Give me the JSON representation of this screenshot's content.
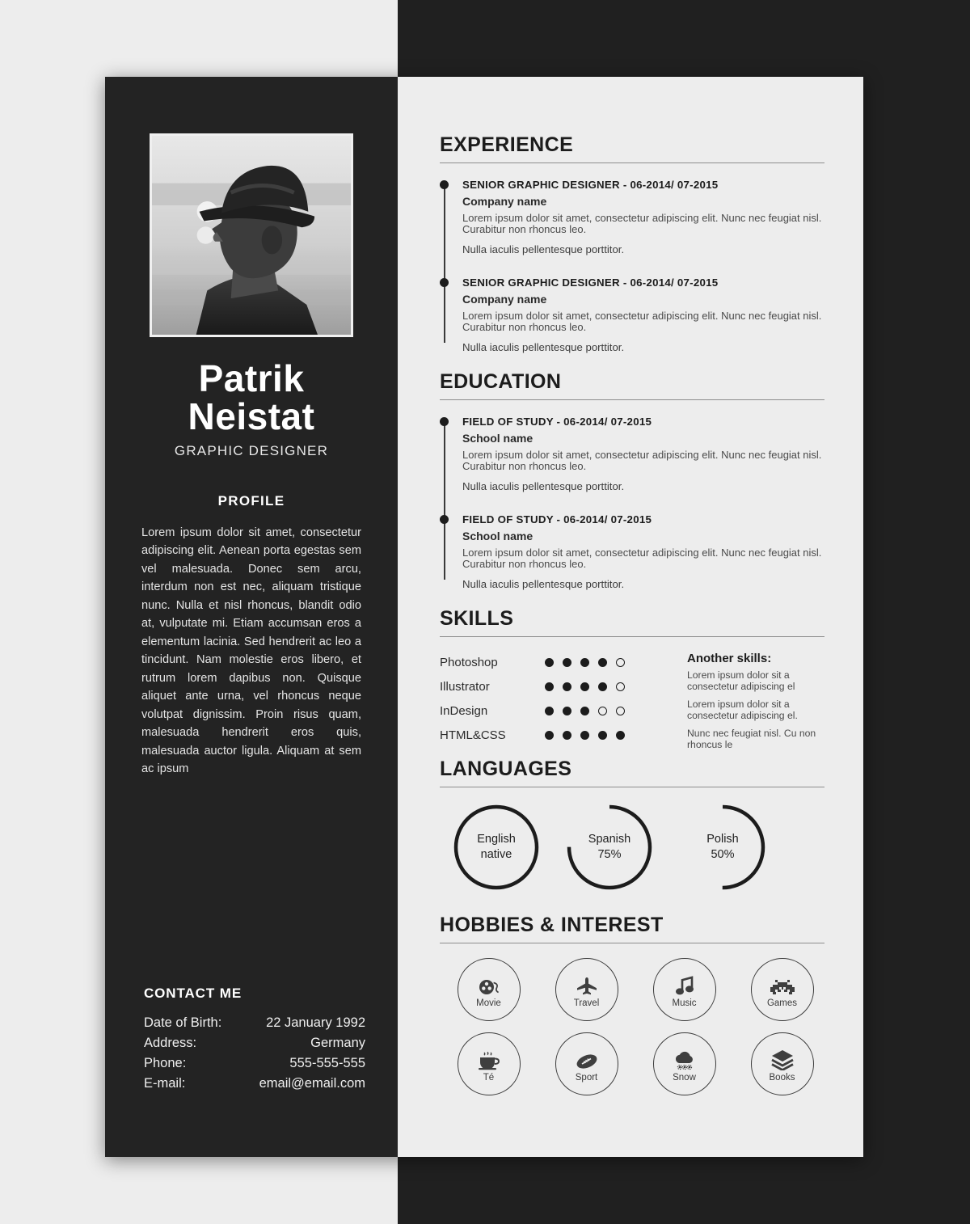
{
  "colors": {
    "page_background": "#ededed",
    "backdrop_dark": "#202020",
    "sidebar_dark": "#232323",
    "ink": "#1c1c1c",
    "rule": "#8d8d8d"
  },
  "sidebar": {
    "photo_alt": "portrait-photo",
    "name_line1": "Patrik",
    "name_line2": "Neistat",
    "role": "GRAPHIC DESIGNER",
    "profile_heading": "PROFILE",
    "profile_text": "Lorem ipsum dolor sit amet, consectetur adipiscing elit. Aenean porta egestas sem vel malesuada. Donec sem arcu, interdum non est nec, aliquam tristique nunc. Nulla et nisl rhoncus, blandit odio at, vulputate mi. Etiam accumsan eros a elementum lacinia. Sed hendrerit ac leo a tincidunt. Nam molestie eros libero, et rutrum lorem dapibus non. Quisque aliquet ante urna, vel rhoncus neque volutpat dignissim. Proin risus quam, malesuada hendrerit eros quis, malesuada auctor ligula. Aliquam at sem ac ipsum",
    "contact": {
      "title": "CONTACT ME",
      "rows": [
        {
          "label": "Date of Birth:",
          "value": "22 January 1992"
        },
        {
          "label": "Address:",
          "value": "Germany"
        },
        {
          "label": "Phone:",
          "value": "555-555-555"
        },
        {
          "label": "E-mail:",
          "value": "email@email.com"
        }
      ]
    }
  },
  "main": {
    "experience": {
      "title": "EXPERIENCE",
      "entries": [
        {
          "role": "SENIOR GRAPHIC DESIGNER - 06-2014/ 07-2015",
          "company": "Company name",
          "description": "Lorem ipsum dolor sit amet, consectetur adipiscing elit. Nunc nec feugiat nisl. Curabitur non rhoncus leo.",
          "note": "Nulla iaculis pellentesque porttitor."
        },
        {
          "role": "SENIOR GRAPHIC DESIGNER - 06-2014/ 07-2015",
          "company": "Company name",
          "description": "Lorem ipsum dolor sit amet, consectetur adipiscing elit. Nunc nec feugiat nisl. Curabitur non rhoncus leo.",
          "note": "Nulla iaculis pellentesque porttitor."
        }
      ]
    },
    "education": {
      "title": "EDUCATION",
      "entries": [
        {
          "role": "FIELD OF STUDY - 06-2014/ 07-2015",
          "company": "School name",
          "description": "Lorem ipsum dolor sit amet, consectetur adipiscing elit. Nunc nec feugiat nisl. Curabitur non rhoncus leo.",
          "note": "Nulla iaculis pellentesque porttitor."
        },
        {
          "role": "FIELD OF STUDY - 06-2014/ 07-2015",
          "company": "School name",
          "description": "Lorem ipsum dolor sit amet, consectetur adipiscing elit. Nunc nec feugiat nisl. Curabitur non rhoncus leo.",
          "note": "Nulla iaculis pellentesque porttitor."
        }
      ]
    },
    "skills": {
      "title": "SKILLS",
      "max_rating": 5,
      "items": [
        {
          "name": "Photoshop",
          "rating": 4
        },
        {
          "name": "Illustrator",
          "rating": 4
        },
        {
          "name": "InDesign",
          "rating": 3
        },
        {
          "name": "HTML&CSS",
          "rating": 5
        }
      ],
      "another_skills_title": "Another skills:",
      "another_skills": [
        "Lorem ipsum dolor sit a consectetur adipiscing el",
        "Lorem ipsum dolor sit a consectetur adipiscing el.",
        "Nunc nec feugiat nisl. Cu non rhoncus le"
      ]
    },
    "languages": {
      "title": "LANGUAGES",
      "items": [
        {
          "name": "English",
          "level_text": "native",
          "percent": 100
        },
        {
          "name": "Spanish",
          "level_text": "75%",
          "percent": 75
        },
        {
          "name": "Polish",
          "level_text": "50%",
          "percent": 50
        }
      ]
    },
    "hobbies": {
      "title": "HOBBIES & INTEREST",
      "items": [
        {
          "label": "Movie",
          "icon": "film-reel-icon"
        },
        {
          "label": "Travel",
          "icon": "airplane-icon"
        },
        {
          "label": "Music",
          "icon": "music-note-icon"
        },
        {
          "label": "Games",
          "icon": "space-invader-icon"
        },
        {
          "label": "Té",
          "icon": "teacup-icon"
        },
        {
          "label": "Sport",
          "icon": "football-icon"
        },
        {
          "label": "Snow",
          "icon": "snow-cloud-icon"
        },
        {
          "label": "Books",
          "icon": "books-stack-icon"
        }
      ]
    }
  }
}
